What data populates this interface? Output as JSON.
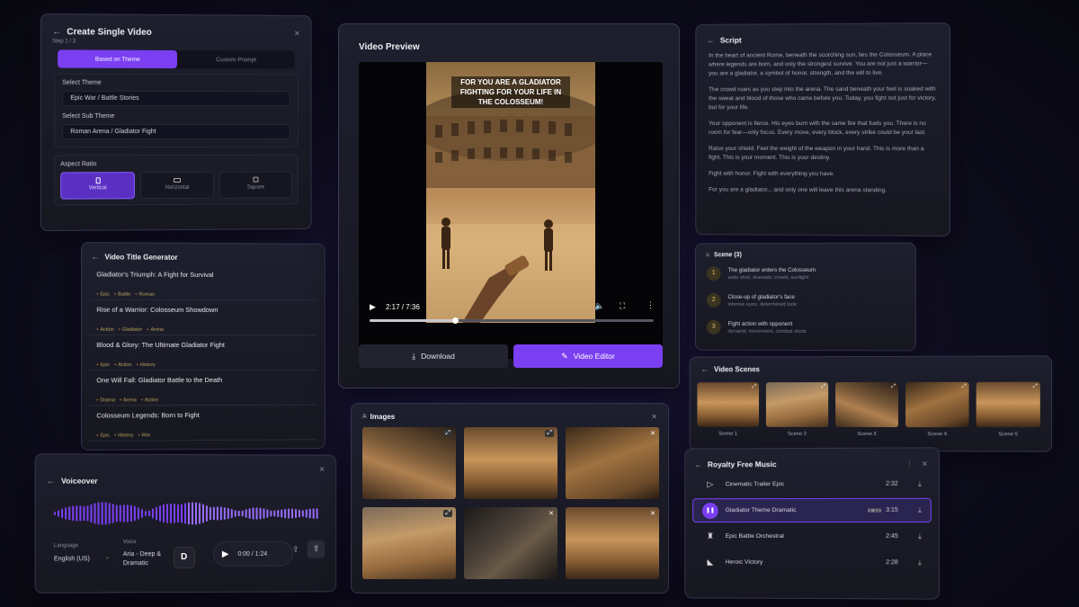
{
  "create": {
    "title": "Create Single Video",
    "step": "Step 1 / 3",
    "tab_theme": "Based on Theme",
    "tab_prompt": "Custom Prompt",
    "theme_label": "Select Theme",
    "theme_value": "Epic War / Battle Stories",
    "subtheme_label": "Select Sub Theme",
    "subtheme_value": "Roman Arena / Gladiator Fight",
    "aspect_label": "Aspect Ratio",
    "aspects": [
      "Vertical",
      "Horizontal",
      "Square"
    ]
  },
  "titles": {
    "title": "Video Title Generator",
    "items": [
      {
        "title": "Gladiator's Triumph: A Fight for Survival",
        "tags": [
          "Epic",
          "Battle",
          "Roman"
        ]
      },
      {
        "title": "Rise of a Warrior: Colosseum Showdown",
        "tags": [
          "Action",
          "Gladiator",
          "Arena"
        ]
      },
      {
        "title": "Blood & Glory: The Ultimate Gladiator Fight",
        "tags": [
          "Epic",
          "Action",
          "History"
        ]
      },
      {
        "title": "One Will Fall: Gladiator Battle to the Death",
        "tags": [
          "Drama",
          "Arena",
          "Action"
        ]
      },
      {
        "title": "Colosseum Legends: Born to Fight",
        "tags": [
          "Epic",
          "History",
          "War"
        ]
      }
    ]
  },
  "voiceover": {
    "title": "Voiceover",
    "language_label": "Language",
    "language_value": "English (US)",
    "voice_label": "Voice",
    "voice_value": "Aria - Deep & Dramatic",
    "time": "0:00 / 1:24"
  },
  "preview": {
    "title": "Video Preview",
    "caption": "FOR YOU ARE A GLADIATOR FIGHTING FOR YOUR LIFE IN THE COLOSSEUM!",
    "time": "2:17 / 7:36",
    "progress": 0.3,
    "download": "Download",
    "editor": "Video Editor"
  },
  "images": {
    "title": "Images"
  },
  "script": {
    "title": "Script",
    "paragraphs": [
      "In the heart of ancient Rome, beneath the scorching sun, lies the Colosseum. A place where legends are born, and only the strongest survive. You are not just a warrior—you are a gladiator, a symbol of honor, strength, and the will to live.",
      "The crowd roars as you step into the arena. The sand beneath your feet is soaked with the sweat and blood of those who came before you. Today, you fight not just for victory, but for your life.",
      "Your opponent is fierce. His eyes burn with the same fire that fuels you. There is no room for fear—only focus. Every move, every block, every strike could be your last.",
      "Raise your shield. Feel the weight of the weapon in your hand. This is more than a fight. This is your moment. This is your destiny.",
      "Fight with honor. Fight with everything you have.",
      "For you are a gladiator... and only one will leave this arena standing."
    ]
  },
  "scenes": {
    "title": "Scene (3)",
    "items": [
      {
        "num": "1",
        "title": "The gladiator enters the Colosseum",
        "desc": "wide shot, dramatic crowd, sunlight"
      },
      {
        "num": "2",
        "title": "Close-up of gladiator's face",
        "desc": "intense eyes, determined look"
      },
      {
        "num": "3",
        "title": "Fight action with opponent",
        "desc": "dynamic movement, combat shots"
      }
    ]
  },
  "video_scenes": {
    "title": "Video Scenes",
    "items": [
      "Scene 1",
      "Scene 2",
      "Scene 3",
      "Scene 4",
      "Scene 5"
    ]
  },
  "music": {
    "title": "Royalty Free Music",
    "tracks": [
      {
        "name": "Cinematic Trailer Epic",
        "time": "2:32"
      },
      {
        "name": "Gladiator Theme Dramatic",
        "time": "3:15"
      },
      {
        "name": "Epic Battle Orchestral",
        "time": "2:45"
      },
      {
        "name": "Heroic Victory",
        "time": "2:28"
      }
    ]
  },
  "colors": {
    "accent": "#7b3ff2",
    "background": "#0d0c1c",
    "panel": "#1a1b26"
  }
}
